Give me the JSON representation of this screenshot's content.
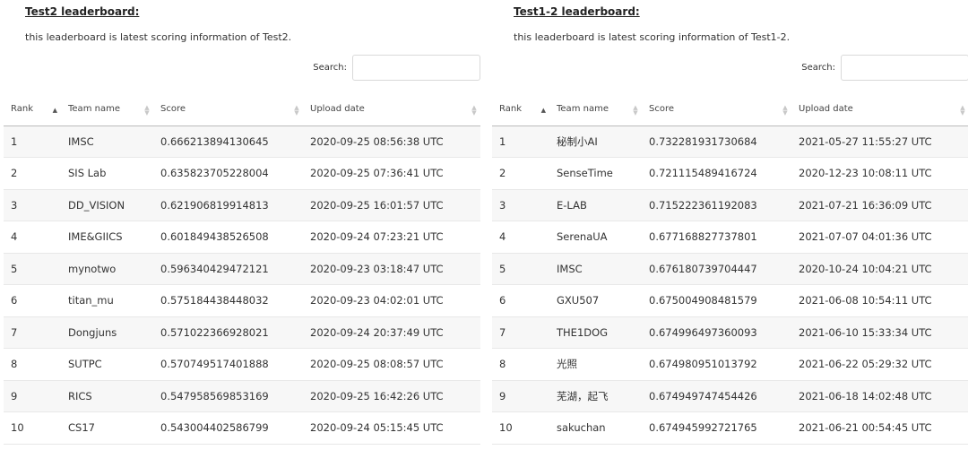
{
  "boards": [
    {
      "title": "Test2 leaderboard:",
      "description": "this leaderboard is latest scoring information of Test2.",
      "search_label": "Search:",
      "search_value": "",
      "columns": [
        "Rank",
        "Team name",
        "Score",
        "Upload date"
      ],
      "rows": [
        [
          "1",
          "IMSC",
          "0.666213894130645",
          "2020-09-25 08:56:38 UTC"
        ],
        [
          "2",
          "SIS Lab",
          "0.635823705228004",
          "2020-09-25 07:36:41 UTC"
        ],
        [
          "3",
          "DD_VISION",
          "0.621906819914813",
          "2020-09-25 16:01:57 UTC"
        ],
        [
          "4",
          "IME&GIICS",
          "0.601849438526508",
          "2020-09-24 07:23:21 UTC"
        ],
        [
          "5",
          "mynotwo",
          "0.596340429472121",
          "2020-09-23 03:18:47 UTC"
        ],
        [
          "6",
          "titan_mu",
          "0.575184438448032",
          "2020-09-23 04:02:01 UTC"
        ],
        [
          "7",
          "Dongjuns",
          "0.571022366928021",
          "2020-09-24 20:37:49 UTC"
        ],
        [
          "8",
          "SUTPC",
          "0.570749517401888",
          "2020-09-25 08:08:57 UTC"
        ],
        [
          "9",
          "RICS",
          "0.547958569853169",
          "2020-09-25 16:42:26 UTC"
        ],
        [
          "10",
          "CS17",
          "0.543004402586799",
          "2020-09-24 05:15:45 UTC"
        ]
      ]
    },
    {
      "title": "Test1-2 leaderboard:",
      "description": "this leaderboard is latest scoring information of Test1-2.",
      "search_label": "Search:",
      "search_value": "",
      "columns": [
        "Rank",
        "Team name",
        "Score",
        "Upload date"
      ],
      "rows": [
        [
          "1",
          "秘制小AI",
          "0.732281931730684",
          "2021-05-27 11:55:27 UTC"
        ],
        [
          "2",
          "SenseTime",
          "0.721115489416724",
          "2020-12-23 10:08:11 UTC"
        ],
        [
          "3",
          "E-LAB",
          "0.715222361192083",
          "2021-07-21 16:36:09 UTC"
        ],
        [
          "4",
          "SerenaUA",
          "0.677168827737801",
          "2021-07-07 04:01:36 UTC"
        ],
        [
          "5",
          "IMSC",
          "0.676180739704447",
          "2020-10-24 10:04:21 UTC"
        ],
        [
          "6",
          "GXU507",
          "0.675004908481579",
          "2021-06-08 10:54:11 UTC"
        ],
        [
          "7",
          "THE1DOG",
          "0.674996497360093",
          "2021-06-10 15:33:34 UTC"
        ],
        [
          "8",
          "光照",
          "0.674980951013792",
          "2021-06-22 05:29:32 UTC"
        ],
        [
          "9",
          "芜湖，起飞",
          "0.674949747454426",
          "2021-06-18 14:02:48 UTC"
        ],
        [
          "10",
          "sakuchan",
          "0.674945992721765",
          "2021-06-21 00:54:45 UTC"
        ]
      ]
    }
  ],
  "icons": {
    "sort_active": "sort-ascending-icon",
    "sort_inactive": "sort-both-icon"
  },
  "colors": {
    "stripe": "#f7f7f7",
    "header_border": "#bcbcbc",
    "row_border": "#e8e8e8"
  }
}
